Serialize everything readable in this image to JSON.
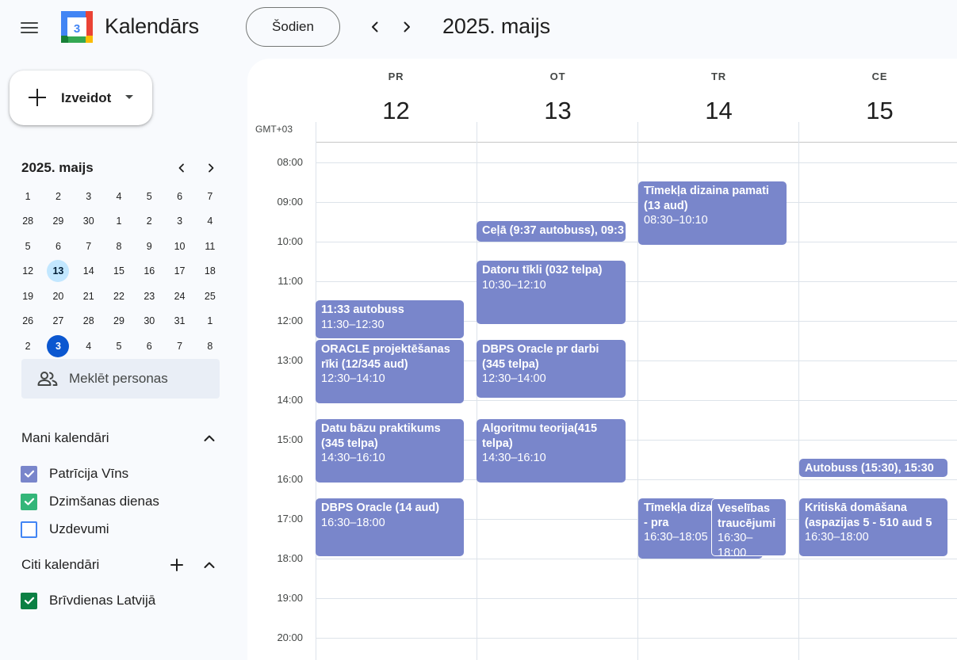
{
  "header": {
    "app_title": "Kalendārs",
    "logo_day": "3",
    "today_button": "Šodien",
    "period_title": "2025. maijs"
  },
  "create_button": {
    "label": "Izveidot"
  },
  "mini_calendar": {
    "title": "2025. maijs",
    "weekday_headers": [
      "1",
      "2",
      "3",
      "4",
      "5",
      "6",
      "7"
    ],
    "weeks": [
      [
        "28",
        "29",
        "30",
        "1",
        "2",
        "3",
        "4"
      ],
      [
        "5",
        "6",
        "7",
        "8",
        "9",
        "10",
        "11"
      ],
      [
        "12",
        "13",
        "14",
        "15",
        "16",
        "17",
        "18"
      ],
      [
        "19",
        "20",
        "21",
        "22",
        "23",
        "24",
        "25"
      ],
      [
        "26",
        "27",
        "28",
        "29",
        "30",
        "31",
        "1"
      ],
      [
        "2",
        "3",
        "4",
        "5",
        "6",
        "7",
        "8"
      ]
    ],
    "selected_day": "13",
    "today_day": "3"
  },
  "search_people": {
    "placeholder": "Meklēt personas"
  },
  "my_calendars": {
    "title": "Mani kalendāri",
    "items": [
      {
        "label": "Patrīcija Vīns",
        "checked": true,
        "color": "#7986cb"
      },
      {
        "label": "Dzimšanas dienas",
        "checked": true,
        "color": "#33b679"
      },
      {
        "label": "Uzdevumi",
        "checked": false,
        "color": "#4285f4"
      }
    ]
  },
  "other_calendars": {
    "title": "Citi kalendāri",
    "items": [
      {
        "label": "Brīvdienas Latvijā",
        "checked": true,
        "color": "#0b8043"
      }
    ]
  },
  "grid": {
    "timezone": "GMT+03",
    "days": [
      {
        "dow": "PR",
        "num": "12"
      },
      {
        "dow": "OT",
        "num": "13"
      },
      {
        "dow": "TR",
        "num": "14"
      },
      {
        "dow": "CE",
        "num": "15"
      }
    ],
    "hours": [
      "08:00",
      "09:00",
      "10:00",
      "11:00",
      "12:00",
      "13:00",
      "14:00",
      "15:00",
      "16:00",
      "17:00",
      "18:00",
      "19:00",
      "20:00"
    ]
  },
  "events": {
    "e1": {
      "title": "11:33 autobuss",
      "time": "11:30–12:30"
    },
    "e2": {
      "title": "ORACLE projektēšanas rīki (12/345 aud)",
      "time": "12:30–14:10"
    },
    "e3": {
      "title": "Datu bāzu praktikums (345 telpa)",
      "time": "14:30–16:10"
    },
    "e4": {
      "title": "DBPS Oracle (14 aud)",
      "time": "16:30–18:00"
    },
    "e5": {
      "title": "Ceļā (9:37 autobuss), 09:3"
    },
    "e6": {
      "title": "Datoru tīkli (032 telpa)",
      "time": "10:30–12:10"
    },
    "e7": {
      "title": "DBPS Oracle pr darbi (345 telpa)",
      "time": "12:30–14:00"
    },
    "e8": {
      "title": "Algoritmu teorija(415 telpa)",
      "time": "14:30–16:10"
    },
    "e9": {
      "title": "Tīmekļa dizaina pamati (13 aud)",
      "time": "08:30–10:10"
    },
    "e10": {
      "title": "Tīmekļa diza pamati - pra",
      "time": "16:30–18:05"
    },
    "e11": {
      "title": "Veselības traucējumi",
      "time": "16:30–18:00"
    },
    "e12": {
      "title": "Autobuss (15:30), 15:30"
    },
    "e13": {
      "title": "Kritiskā domāšana (aspazijas 5 - 510 aud 5",
      "time": "16:30–18:00"
    }
  }
}
